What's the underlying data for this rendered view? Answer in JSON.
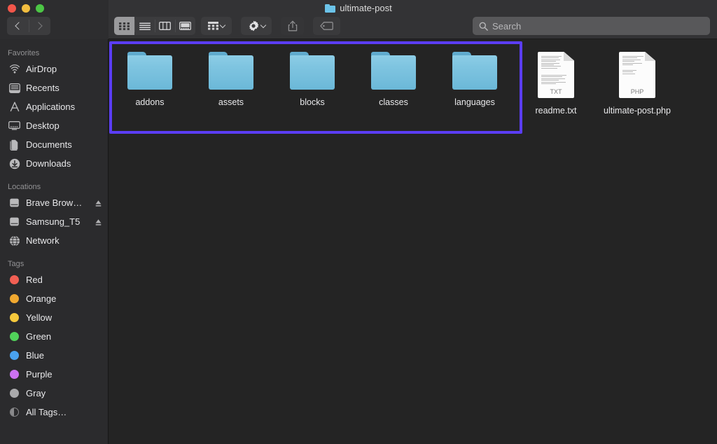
{
  "window": {
    "title": "ultimate-post",
    "title_icon": "folder-icon",
    "traffic_lights": [
      {
        "name": "close",
        "color": "#f2564a"
      },
      {
        "name": "minimize",
        "color": "#f2bd3f"
      },
      {
        "name": "zoom",
        "color": "#4cc645"
      }
    ]
  },
  "toolbar": {
    "back_label": "Back",
    "forward_label": "Forward",
    "view_modes": [
      {
        "id": "icon",
        "label": "Icon View",
        "icon": "grid-icon",
        "active": true
      },
      {
        "id": "list",
        "label": "List View",
        "icon": "list-icon",
        "active": false
      },
      {
        "id": "column",
        "label": "Column View",
        "icon": "columns-icon",
        "active": false
      },
      {
        "id": "gallery",
        "label": "Gallery View",
        "icon": "gallery-icon",
        "active": false
      }
    ],
    "group_label": "Group Items",
    "group_icon": "group-icon",
    "action_label": "Action",
    "action_icon": "gear-icon",
    "share_label": "Share",
    "share_icon": "share-icon",
    "tags_label": "Tags",
    "tags_icon": "tag-icon"
  },
  "search": {
    "placeholder": "Search",
    "value": "",
    "icon": "search-icon"
  },
  "sidebar": {
    "sections": [
      {
        "header": "Favorites",
        "items": [
          {
            "label": "AirDrop",
            "icon": "airdrop-icon",
            "eject": false
          },
          {
            "label": "Recents",
            "icon": "recents-icon",
            "eject": false
          },
          {
            "label": "Applications",
            "icon": "applications-icon",
            "eject": false
          },
          {
            "label": "Desktop",
            "icon": "desktop-icon",
            "eject": false
          },
          {
            "label": "Documents",
            "icon": "documents-icon",
            "eject": false
          },
          {
            "label": "Downloads",
            "icon": "downloads-icon",
            "eject": false
          }
        ]
      },
      {
        "header": "Locations",
        "items": [
          {
            "label": "Brave Brow…",
            "icon": "drive-icon",
            "eject": true
          },
          {
            "label": "Samsung_T5",
            "icon": "drive-icon",
            "eject": true
          },
          {
            "label": "Network",
            "icon": "network-icon",
            "eject": false
          }
        ]
      },
      {
        "header": "Tags",
        "items": [
          {
            "label": "Red",
            "icon": "tag-dot",
            "color": "#f25f53"
          },
          {
            "label": "Orange",
            "icon": "tag-dot",
            "color": "#f0a830"
          },
          {
            "label": "Yellow",
            "icon": "tag-dot",
            "color": "#f6c93c"
          },
          {
            "label": "Green",
            "icon": "tag-dot",
            "color": "#51d15a"
          },
          {
            "label": "Blue",
            "icon": "tag-dot",
            "color": "#4aa3f0"
          },
          {
            "label": "Purple",
            "icon": "tag-dot",
            "color": "#cb71f2"
          },
          {
            "label": "Gray",
            "icon": "tag-dot",
            "color": "#a9a9ab"
          },
          {
            "label": "All Tags…",
            "icon": "all-tags-icon",
            "color": "#8a8a8c"
          }
        ]
      }
    ]
  },
  "content": {
    "selection_highlight_color": "#5b3df5",
    "items": [
      {
        "name": "addons",
        "type": "folder",
        "selected": true
      },
      {
        "name": "assets",
        "type": "folder",
        "selected": true
      },
      {
        "name": "blocks",
        "type": "folder",
        "selected": true
      },
      {
        "name": "classes",
        "type": "folder",
        "selected": true
      },
      {
        "name": "languages",
        "type": "folder",
        "selected": true
      },
      {
        "name": "readme.txt",
        "type": "document",
        "kind": "TXT",
        "selected": false
      },
      {
        "name": "ultimate-post.php",
        "type": "document",
        "kind": "PHP",
        "selected": false
      }
    ]
  }
}
